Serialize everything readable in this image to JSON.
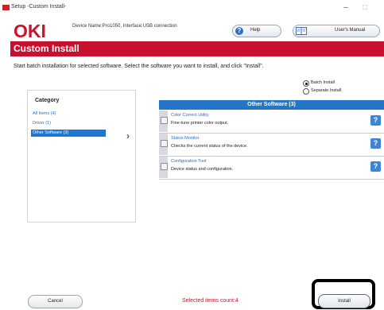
{
  "window": {
    "title": "Setup -Custom Install-",
    "minimize_glyph": "–",
    "maximize_glyph": "□"
  },
  "header": {
    "logo": "OKI",
    "device_info": "Device Name:Pro1050, Interface:USB connection",
    "help_label": "Help",
    "help_icon_glyph": "?",
    "manual_label": "User's Manual",
    "brand_color": "#c8102e"
  },
  "banner": {
    "title": "Custom Install"
  },
  "instructions": "Start batch installation for selected software. Select the software you want to install, and click \"Install\".",
  "install_mode": {
    "options": [
      {
        "label": "Batch Install",
        "selected": true
      },
      {
        "label": "Separate Install",
        "selected": false
      }
    ]
  },
  "category": {
    "heading": "Category",
    "items": [
      {
        "label": "All Items (4)",
        "selected": false
      },
      {
        "label": "Driver (1)",
        "selected": false
      },
      {
        "label": "Other Software (3)",
        "selected": true
      }
    ],
    "arrow_glyph": "›"
  },
  "software_list": {
    "heading": "Other Software (3)",
    "items": [
      {
        "name": "Color Correct Utility",
        "description": "Fine-tune printer color output."
      },
      {
        "name": "Status Monitor",
        "description": "Checks the current status of the device."
      },
      {
        "name": "Configuration Tool",
        "description": "Device status and configuration."
      }
    ],
    "help_glyph": "?"
  },
  "footer": {
    "cancel_label": "Cancel",
    "selected_count": "Selected items count:4",
    "install_label": "Install"
  }
}
